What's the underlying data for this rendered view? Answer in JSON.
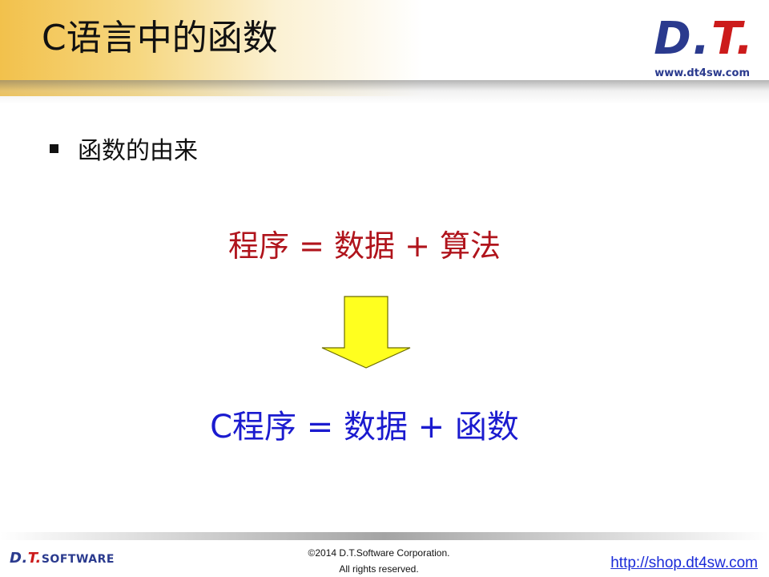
{
  "slide": {
    "title": "C语言中的函数",
    "bullet": "函数的由来",
    "formula_top": "程序 = 数据 + 算法",
    "formula_bottom": "C程序 = 数据 + 函数"
  },
  "logo": {
    "mark_dt": "D.",
    "mark_t": "T.",
    "url": "www.dt4sw.com"
  },
  "footer": {
    "logo_dt": "D.",
    "logo_t": "T.",
    "logo_software": "SOFTWARE",
    "copyright_line1": "©2014 D.T.Software Corporation.",
    "copyright_line2": "All rights reserved.",
    "link": "http://shop.dt4sw.com"
  },
  "colors": {
    "formula_top": "#b0141c",
    "formula_bottom": "#1b1bcf",
    "arrow_fill": "#ffff1f",
    "brand_blue": "#2a3a8e",
    "brand_red": "#cc1b1b"
  }
}
